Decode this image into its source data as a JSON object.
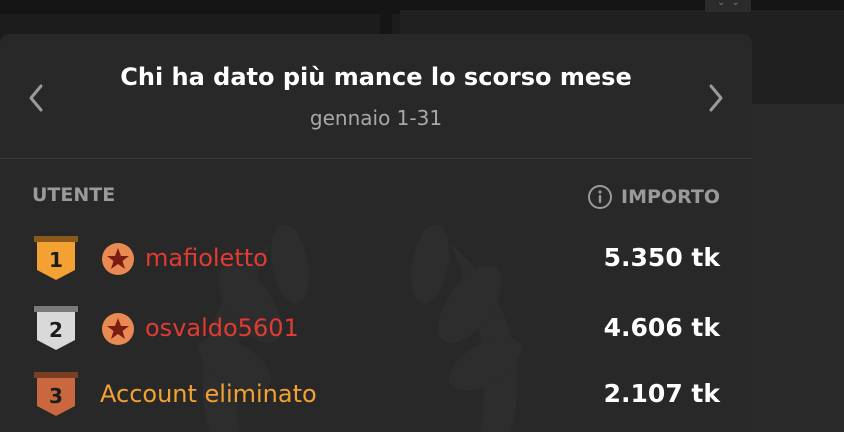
{
  "panel": {
    "title": "Chi ha dato più mance lo scorso mese",
    "subtitle": "gennaio 1-31"
  },
  "columns": {
    "user": "UTENTE",
    "amount": "IMPORTO"
  },
  "rows": [
    {
      "rank": "1",
      "name": "mafioletto",
      "amount": "5.350 tk",
      "medal": "gold",
      "badge": "star-badge-icon"
    },
    {
      "rank": "2",
      "name": "osvaldo5601",
      "amount": "4.606 tk",
      "medal": "silver",
      "badge": "star-badge-icon"
    },
    {
      "rank": "3",
      "name": "Account eliminato",
      "amount": "2.107 tk",
      "medal": "bronze",
      "badge": ""
    }
  ],
  "colors": {
    "username": "#e13b33",
    "deleted": "#f2a132",
    "gold": "#f2a132",
    "silver": "#d9d9d9",
    "bronze": "#c9683e"
  }
}
